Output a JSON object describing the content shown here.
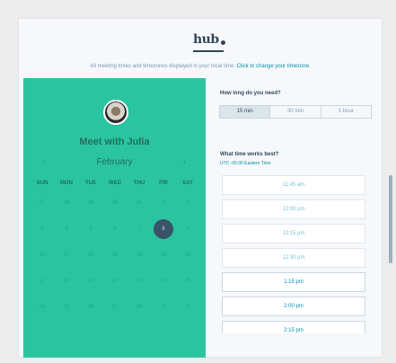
{
  "header": {
    "logo_text": "hub",
    "subtitle_text": "All meeting times and timezones displayed in your local time.",
    "subtitle_link": "Click to change your timezone."
  },
  "calendar": {
    "title": "Meet with Julia",
    "month": "February",
    "prev_arrow": "‹",
    "next_arrow": "›",
    "weekdays": [
      "SUN",
      "MON",
      "TUE",
      "WED",
      "THU",
      "FRI",
      "SAT"
    ],
    "weeks": [
      [
        "27",
        "28",
        "29",
        "30",
        "31",
        "1",
        "2"
      ],
      [
        "3",
        "4",
        "5",
        "6",
        "7",
        "8",
        "9"
      ],
      [
        "10",
        "11",
        "12",
        "13",
        "14",
        "15",
        "16"
      ],
      [
        "17",
        "18",
        "19",
        "20",
        "21",
        "22",
        "23"
      ],
      [
        "24",
        "25",
        "26",
        "27",
        "28",
        "1",
        "2"
      ]
    ],
    "selected_day": "8"
  },
  "booking": {
    "duration_question": "How long do you need?",
    "duration_options": [
      "15 min",
      "30 min",
      "1 hour"
    ],
    "duration_selected": "15 min",
    "time_question": "What time works best?",
    "timezone_label": "UTC -05:00 Eastern Time",
    "slots": [
      "11:45 am",
      "12:00 pm",
      "12:15 pm",
      "12:30 pm",
      "1:15 pm",
      "2:00 pm",
      "2:15 pm"
    ]
  },
  "colors": {
    "panel": "#2bc4a0",
    "selected_day": "#3a5368",
    "accent_link": "#0091ae"
  }
}
